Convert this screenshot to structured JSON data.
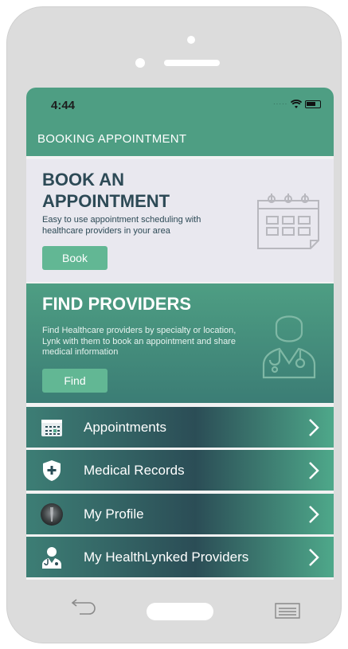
{
  "status_bar": {
    "time": "4:44"
  },
  "header": {
    "title": "BOOKING APPOINTMENT"
  },
  "book_card": {
    "title_line1": "BOOK AN",
    "title_line2": "APPOINTMENT",
    "description": "Easy to use appointment scheduling with healthcare providers in your area",
    "button_label": "Book",
    "icon": "calendar-icon"
  },
  "find_card": {
    "title": "FIND PROVIDERS",
    "description": "Find Healthcare providers by specialty or location, Lynk with them to book an appointment and share medical information",
    "button_label": "Find",
    "icon": "doctor-icon"
  },
  "menu": {
    "items": [
      {
        "label": "Appointments",
        "icon": "calendar-icon"
      },
      {
        "label": "Medical Records",
        "icon": "shield-plus-icon"
      },
      {
        "label": "My Profile",
        "icon": "avatar"
      },
      {
        "label": "My HealthLynked Providers",
        "icon": "doctor-icon"
      }
    ]
  },
  "colors": {
    "brand_green": "#4e9e83",
    "button_green": "#62b794",
    "dark_slate": "#2d4a56",
    "card_light": "#e9e8ef"
  }
}
